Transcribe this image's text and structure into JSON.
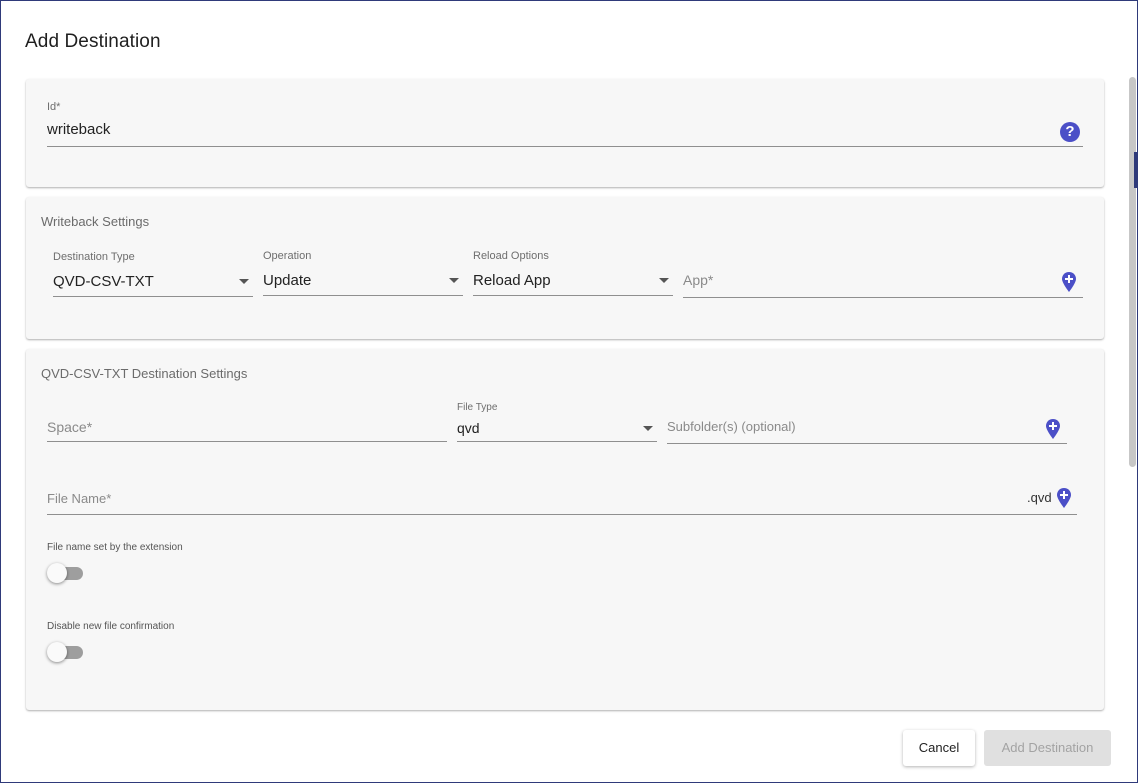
{
  "dialog": {
    "title": "Add Destination"
  },
  "id_field": {
    "label": "Id*",
    "value": "writeback",
    "help_icon": "question-circle-icon"
  },
  "writeback_settings": {
    "title": "Writeback Settings",
    "destination_type": {
      "label": "Destination Type",
      "value": "QVD-CSV-TXT"
    },
    "operation": {
      "label": "Operation",
      "value": "Update"
    },
    "reload_options": {
      "label": "Reload Options",
      "value": "Reload App"
    },
    "app": {
      "placeholder": "App*",
      "icon": "add-pin-icon"
    }
  },
  "destination_settings": {
    "title": "QVD-CSV-TXT Destination Settings",
    "space": {
      "placeholder": "Space*"
    },
    "file_type": {
      "label": "File Type",
      "value": "qvd"
    },
    "subfolder": {
      "placeholder": "Subfolder(s) (optional)",
      "icon": "add-pin-icon"
    },
    "file_name": {
      "placeholder": "File Name*",
      "suffix": ".qvd",
      "icon": "add-pin-icon"
    },
    "file_name_by_extension": {
      "label": "File name set by the extension",
      "checked": false
    },
    "disable_confirmation": {
      "label": "Disable new file confirmation",
      "checked": false
    }
  },
  "actions": {
    "cancel_label": "Cancel",
    "add_label": "Add Destination"
  },
  "colors": {
    "accent": "#4b4fc7",
    "disabled_button": "#e0e0e0"
  }
}
